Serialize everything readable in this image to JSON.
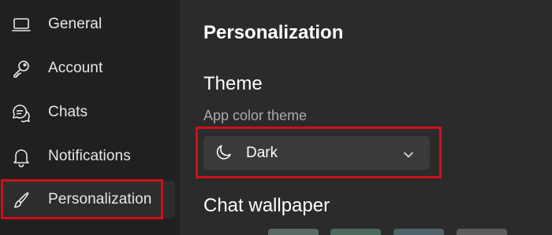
{
  "sidebar": {
    "items": [
      {
        "label": "General",
        "icon": "laptop-icon"
      },
      {
        "label": "Account",
        "icon": "key-icon"
      },
      {
        "label": "Chats",
        "icon": "chat-bubbles-icon"
      },
      {
        "label": "Notifications",
        "icon": "bell-icon"
      },
      {
        "label": "Personalization",
        "icon": "brush-icon",
        "active": true
      }
    ]
  },
  "main": {
    "title": "Personalization",
    "theme": {
      "heading": "Theme",
      "sub_label": "App color theme",
      "selected": "Dark",
      "selected_icon": "moon-icon"
    },
    "wallpaper": {
      "heading": "Chat wallpaper",
      "swatches": [
        "#5a6a62",
        "#4f6a5c",
        "#4f6368",
        "#5c5c5c"
      ]
    }
  },
  "colors": {
    "sidebar_bg": "#202020",
    "main_bg": "#2b2b2b",
    "highlight": "#d0101a",
    "dropdown_bg": "#3a3a3a"
  }
}
